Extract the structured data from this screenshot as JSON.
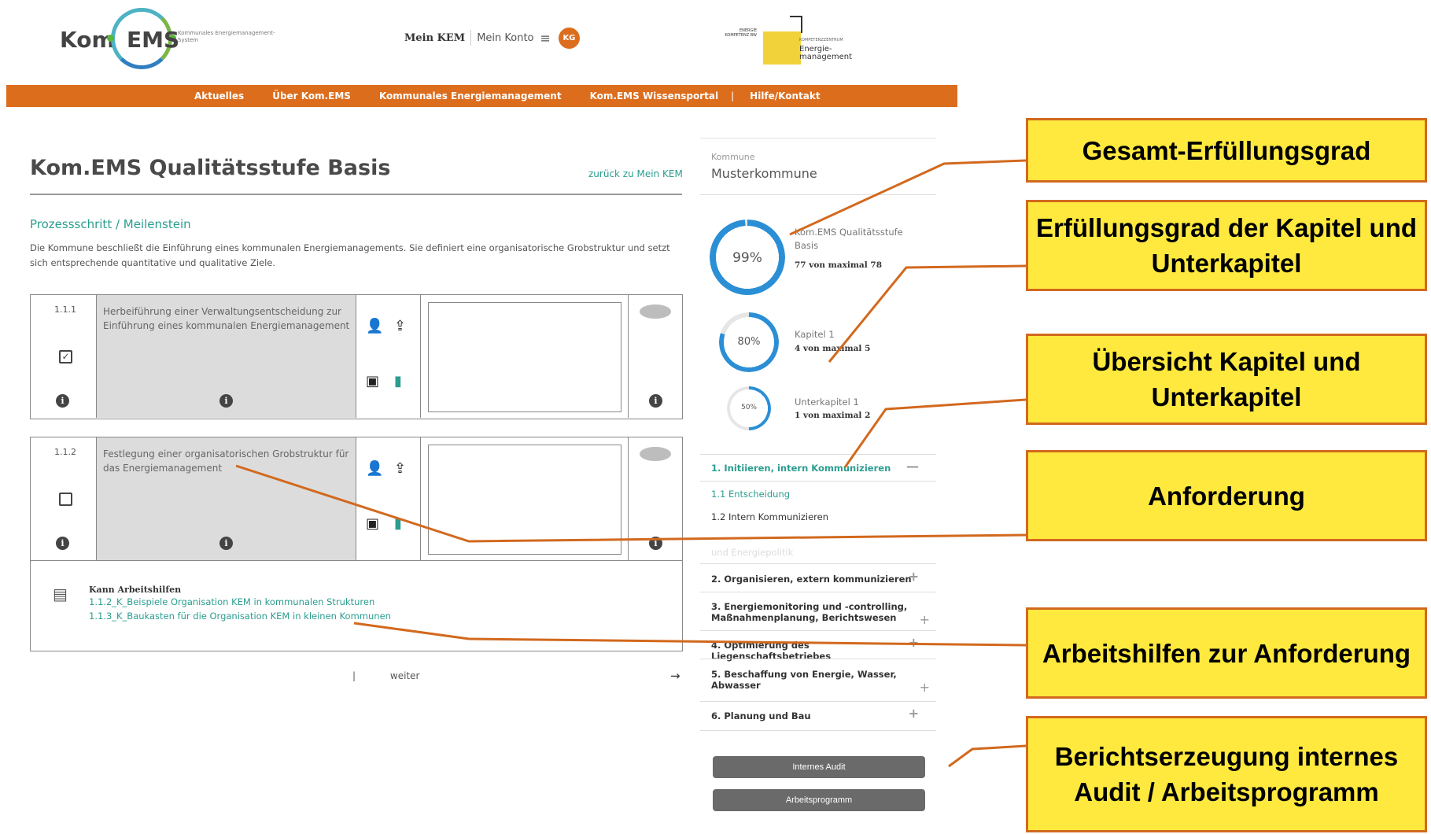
{
  "brand": {
    "kom": "Kom",
    "ems": "EMS",
    "subtitle": "Kommunales Energiemanagement-System"
  },
  "topnav": {
    "mein_kem": "Mein KEM",
    "mein_konto": "Mein Konto",
    "menu_icon": "hamburger-icon",
    "avatar": "KG"
  },
  "partner": {
    "small": "ENERGIE KOMPETENZ BW",
    "kompetenz": "KOMPETENZZENTRUM",
    "line1": "Energie-",
    "line2": "management"
  },
  "mainnav": {
    "items": [
      "Aktuelles",
      "Über Kom.EMS",
      "Kommunales Energiemanagement",
      "Kom.EMS Wissensportal"
    ],
    "separator": "|",
    "help": "Hilfe/Kontakt"
  },
  "page": {
    "title": "Kom.EMS Qualitätsstufe Basis",
    "back_link": "zurück zu Mein KEM",
    "section_title": "Prozessschritt / Meilenstein",
    "section_desc": "Die Kommune beschließt die Einführung eines kommunalen Energiemanagements. Sie definiert eine organisatorische Grobstruktur und setzt sich entsprechende quantitative und qualitative Ziele."
  },
  "requirements": [
    {
      "number": "1.1.1",
      "checked": true,
      "text": "Herbeiführung einer Verwaltungsentscheidung zur Einführung eines kommunalen Energiemanagement"
    },
    {
      "number": "1.1.2",
      "checked": false,
      "text": "Festlegung einer organisatorischen Grobstruktur für das Energiemanagement"
    }
  ],
  "helpers": {
    "title": "Kann Arbeitshilfen",
    "links": [
      "1.1.2_K_Beispiele Organisation KEM in kommunalen Strukturen",
      "1.1.3_K_Baukasten für die Organisation KEM in kleinen Kommunen"
    ]
  },
  "pager": {
    "separator": "|",
    "next": "weiter",
    "arrow": "→"
  },
  "sidebar": {
    "commune_label": "Kommune",
    "commune": "Musterkommune",
    "overall": {
      "percent_text": "99%",
      "percent": 99,
      "label": "Kom.EMS Qualitätsstufe Basis",
      "sub": "77 von maximal 78"
    },
    "chapter": {
      "percent_text": "80%",
      "percent": 80,
      "label": "Kapitel 1",
      "sub": "4 von maximal 5"
    },
    "subchapter": {
      "percent_text": "50%",
      "percent": 50,
      "label": "Unterkapitel 1",
      "sub": "1 von maximal 2"
    },
    "chapters": [
      {
        "label": "1. Initiieren, intern Kommunizieren",
        "sign": "—"
      },
      {
        "label": "2. Organisieren, extern kommunizieren",
        "sign": "+"
      },
      {
        "label": "3. Energiemonitoring und -controlling, Maßnahmenplanung, Berichtswesen",
        "sign": "+"
      },
      {
        "label": "4. Optimierung des Liegenschaftsbetriebes",
        "sign": "+"
      },
      {
        "label": "5. Beschaffung von Energie, Wasser, Abwasser",
        "sign": "+"
      },
      {
        "label": "6. Planung und Bau",
        "sign": "+"
      }
    ],
    "subchapters": [
      "1.1 Entscheidung",
      "1.2 Intern Kommunizieren",
      "und Energiepolitik"
    ],
    "buttons": {
      "audit": "Internes Audit",
      "program": "Arbeitsprogramm"
    }
  },
  "callouts": [
    "Gesamt-Erfüllungsgrad",
    "Erfüllungsgrad der Kapitel und Unterkapitel",
    "Übersicht Kapitel und Unterkapitel",
    "Anforderung",
    "Arbeitshilfen zur Anforderung",
    "Berichtserzeugung internes Audit / Arbeitsprogramm"
  ],
  "colors": {
    "accent": "#dc6d1d",
    "teal": "#2a9d8f",
    "ring_blue": "#2b8fd6",
    "callout_fill": "#ffe93e",
    "callout_border": "#d2691e"
  }
}
